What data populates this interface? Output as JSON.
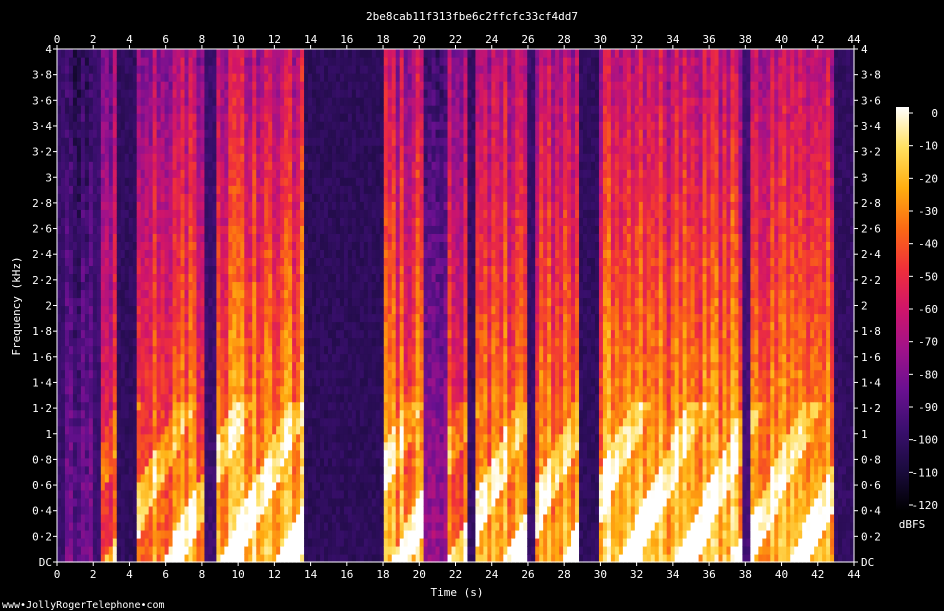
{
  "chart_data": {
    "type": "heatmap",
    "title": "2be8cab11f313fbe6c2ffcfc33cf4dd7",
    "xlabel": "Time (s)",
    "ylabel": "Frequency (kHz)",
    "xlim": [
      0,
      44
    ],
    "ylim": [
      0,
      4
    ],
    "x_ticks": [
      "0",
      "2",
      "4",
      "6",
      "8",
      "10",
      "12",
      "14",
      "16",
      "18",
      "20",
      "22",
      "24",
      "26",
      "28",
      "30",
      "32",
      "34",
      "36",
      "38",
      "40",
      "42",
      "44"
    ],
    "y_ticks": [
      "DC",
      "0·2",
      "0·4",
      "0·6",
      "0·8",
      "1",
      "1·2",
      "1·4",
      "1·6",
      "1·8",
      "2",
      "2·2",
      "2·4",
      "2·6",
      "2·8",
      "3",
      "3·2",
      "3·4",
      "3·6",
      "3·8",
      "4"
    ],
    "colorbar": {
      "label": "dBFS",
      "range": [
        -120,
        0
      ],
      "ticks": [
        "0",
        "-10",
        "-20",
        "-30",
        "-40",
        "-50",
        "-60",
        "-70",
        "-80",
        "-90",
        "-100",
        "-110",
        "-120"
      ],
      "colors": [
        "#000000",
        "#1a0b3d",
        "#3a0f6e",
        "#6a1090",
        "#a0128a",
        "#d0156a",
        "#f0303a",
        "#fb6a14",
        "#ffae10",
        "#ffe060",
        "#ffffff"
      ]
    },
    "energy_segments": [
      {
        "start": 0.0,
        "end": 0.4,
        "level": 0.18
      },
      {
        "start": 0.4,
        "end": 2.0,
        "level": 0.32
      },
      {
        "start": 2.0,
        "end": 2.5,
        "level": 0.22
      },
      {
        "start": 2.5,
        "end": 3.2,
        "level": 0.68
      },
      {
        "start": 3.2,
        "end": 4.4,
        "level": 0.12
      },
      {
        "start": 4.4,
        "end": 8.1,
        "level": 0.82
      },
      {
        "start": 8.1,
        "end": 8.7,
        "level": 0.2
      },
      {
        "start": 8.7,
        "end": 13.7,
        "level": 0.9
      },
      {
        "start": 13.7,
        "end": 18.0,
        "level": 0.1
      },
      {
        "start": 18.0,
        "end": 20.2,
        "level": 0.85
      },
      {
        "start": 20.2,
        "end": 21.6,
        "level": 0.45
      },
      {
        "start": 21.6,
        "end": 22.7,
        "level": 0.75
      },
      {
        "start": 22.7,
        "end": 23.0,
        "level": 0.15
      },
      {
        "start": 23.0,
        "end": 25.9,
        "level": 0.85
      },
      {
        "start": 25.9,
        "end": 26.3,
        "level": 0.18
      },
      {
        "start": 26.3,
        "end": 28.8,
        "level": 0.84
      },
      {
        "start": 28.8,
        "end": 29.9,
        "level": 0.12
      },
      {
        "start": 29.9,
        "end": 37.8,
        "level": 0.9
      },
      {
        "start": 37.8,
        "end": 38.3,
        "level": 0.25
      },
      {
        "start": 38.3,
        "end": 42.9,
        "level": 0.85
      },
      {
        "start": 42.9,
        "end": 44.0,
        "level": 0.14
      }
    ]
  },
  "footer": {
    "credit": "www•JollyRogerTelephone•com"
  }
}
